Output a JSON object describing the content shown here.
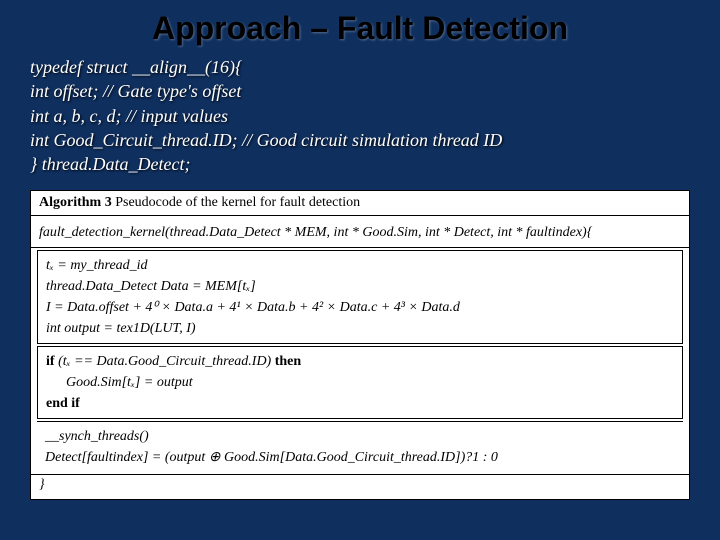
{
  "title": "Approach – Fault Detection",
  "code": {
    "l1": "typedef struct __align__(16){",
    "l2": "int offset; // Gate type's offset",
    "l3": "int a, b, c, d; // input values",
    "l4": "int Good_Circuit_thread.ID; // Good circuit simulation thread ID",
    "l5": "} thread.Data_Detect;"
  },
  "algo": {
    "header_label": "Algorithm 3",
    "header_text": " Pseudocode of the kernel for fault detection",
    "sig": "fault_detection_kernel(thread.Data_Detect   *   MEM,  int   *   Good.Sim,  int   *  Detect, int * faultindex){",
    "s1l1": "tₓ = my_thread_id",
    "s1l2": "thread.Data_Detect Data = MEM[tₓ]",
    "s1l3": "I = Data.offset + 4⁰ × Data.a + 4¹ × Data.b + 4² × Data.c + 4³ × Data.d",
    "s1l4": "int output = tex1D(LUT, I)",
    "if_kw": "if ",
    "if_cond": "(tₓ == Data.Good_Circuit_thread.ID)",
    "then_kw": " then",
    "s2l2": "Good.Sim[tₓ] = output",
    "endif": "end if",
    "s3l1": "__synch_threads()",
    "s3l2": "Detect[faultindex] = (output ⊕ Good.Sim[Data.Good_Circuit_thread.ID])?1 : 0",
    "close": "}"
  }
}
